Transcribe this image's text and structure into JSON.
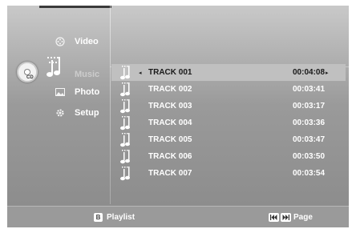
{
  "menu": {
    "items": [
      {
        "label": "Video",
        "icon": "film-reel-icon"
      },
      {
        "label": "Music",
        "icon": "music-note-icon",
        "selected": true
      },
      {
        "label": "Photo",
        "icon": "photo-icon"
      },
      {
        "label": "Setup",
        "icon": "gear-icon"
      }
    ],
    "disc_label": "CD"
  },
  "tracks": [
    {
      "title": "TRACK 001",
      "time": "00:04:08",
      "selected": true
    },
    {
      "title": "TRACK 002",
      "time": "00:03:41"
    },
    {
      "title": "TRACK 003",
      "time": "00:03:17"
    },
    {
      "title": "TRACK 004",
      "time": "00:03:36"
    },
    {
      "title": "TRACK 005",
      "time": "00:03:47"
    },
    {
      "title": "TRACK 006",
      "time": "00:03:50"
    },
    {
      "title": "TRACK 007",
      "time": "00:03:54"
    }
  ],
  "bottom_bar": {
    "playlist_key": "B",
    "playlist_label": "Playlist",
    "page_label": "Page"
  }
}
